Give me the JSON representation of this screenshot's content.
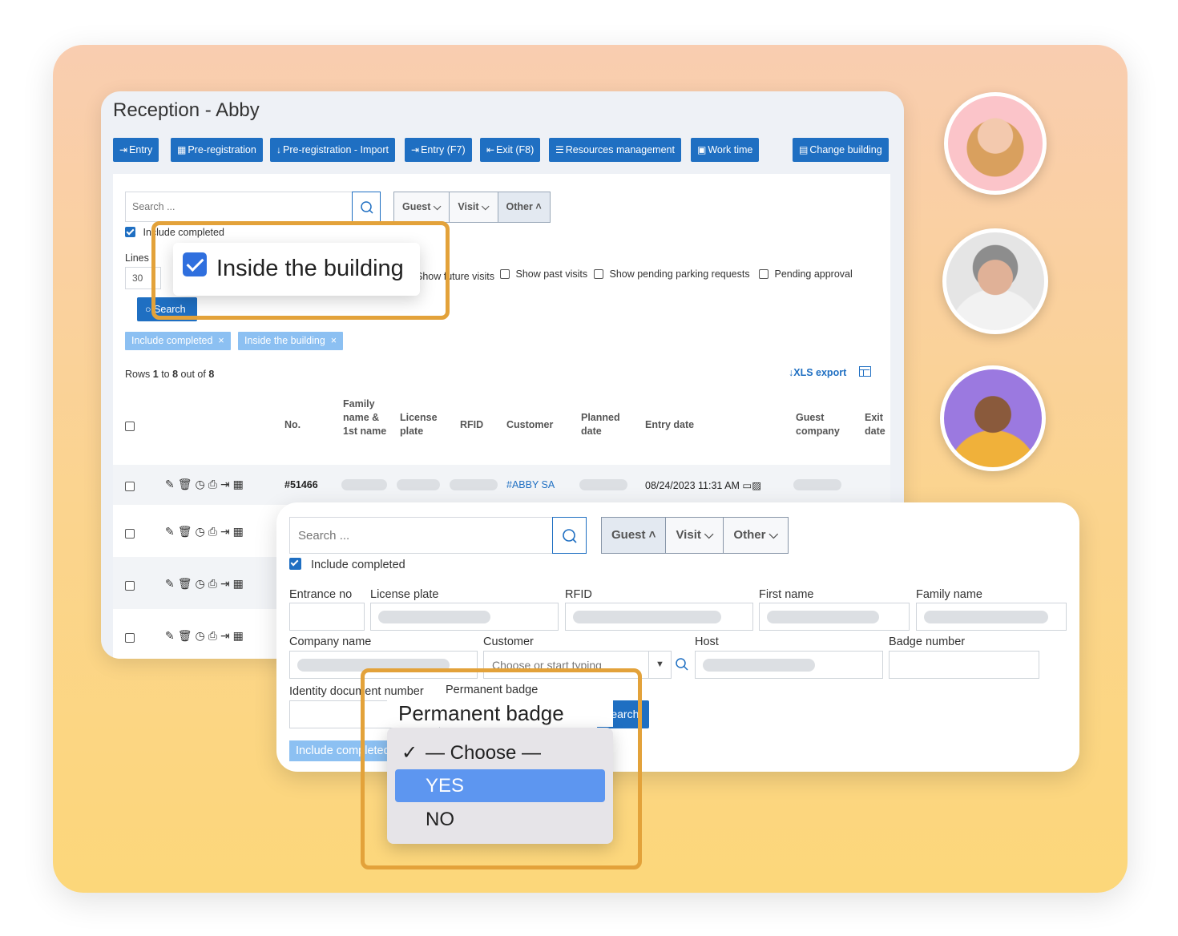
{
  "window": {
    "title": "Reception - Abby",
    "toolbar": [
      "Entry",
      "Pre-registration",
      "Pre-registration - Import",
      "Entry (F7)",
      "Exit (F8)",
      "Resources management",
      "Work time",
      "Change building"
    ]
  },
  "filters": {
    "search_placeholder": "Search ...",
    "segments": [
      "Guest",
      "Visit",
      "Other"
    ],
    "include_completed": "Include completed",
    "lines_label": "Lines",
    "lines_value": "30",
    "options": [
      "Show future visits",
      "Show past visits",
      "Show pending parking requests",
      "Pending approval"
    ],
    "search_button": "Search",
    "tags": [
      "Include completed",
      "Inside the building"
    ]
  },
  "callout_inside": "Inside the building",
  "results": {
    "rows_text_prefix": "Rows",
    "rows_from": "1",
    "rows_to_word": "to",
    "rows_to": "8",
    "rows_outof_word": "out of",
    "rows_total": "8",
    "xls_export": "XLS export"
  },
  "table": {
    "headers": [
      "No.",
      "Family name & 1st name",
      "License plate",
      "RFID",
      "Customer",
      "Planned date",
      "Entry date",
      "Guest company",
      "Exit date"
    ],
    "first_row": {
      "no": "#51466",
      "customer": "#ABBY SA",
      "entry_date": "08/24/2023 11:31 AM"
    }
  },
  "front": {
    "search_placeholder": "Search ...",
    "segments": [
      "Guest",
      "Visit",
      "Other"
    ],
    "include_completed": "Include completed",
    "labels": {
      "entrance_no": "Entrance no",
      "license_plate": "License plate",
      "rfid": "RFID",
      "first_name": "First name",
      "family_name": "Family name",
      "company_name": "Company name",
      "customer": "Customer",
      "host": "Host",
      "badge_number": "Badge number",
      "identity_document": "Identity document number",
      "permanent_badge": "Permanent badge"
    },
    "customer_placeholder": "Choose or start typing",
    "search_button": "Search",
    "tag": "Include completed"
  },
  "dropdown": {
    "title": "Permanent badge",
    "options": [
      "— Choose —",
      "YES",
      "NO"
    ],
    "checked": "— Choose —",
    "highlighted": "YES"
  },
  "colors": {
    "primary": "#1f6fc2",
    "tag": "#8cc0f2",
    "highlight": "#e3a23a",
    "option_selected": "#5d96f0"
  }
}
